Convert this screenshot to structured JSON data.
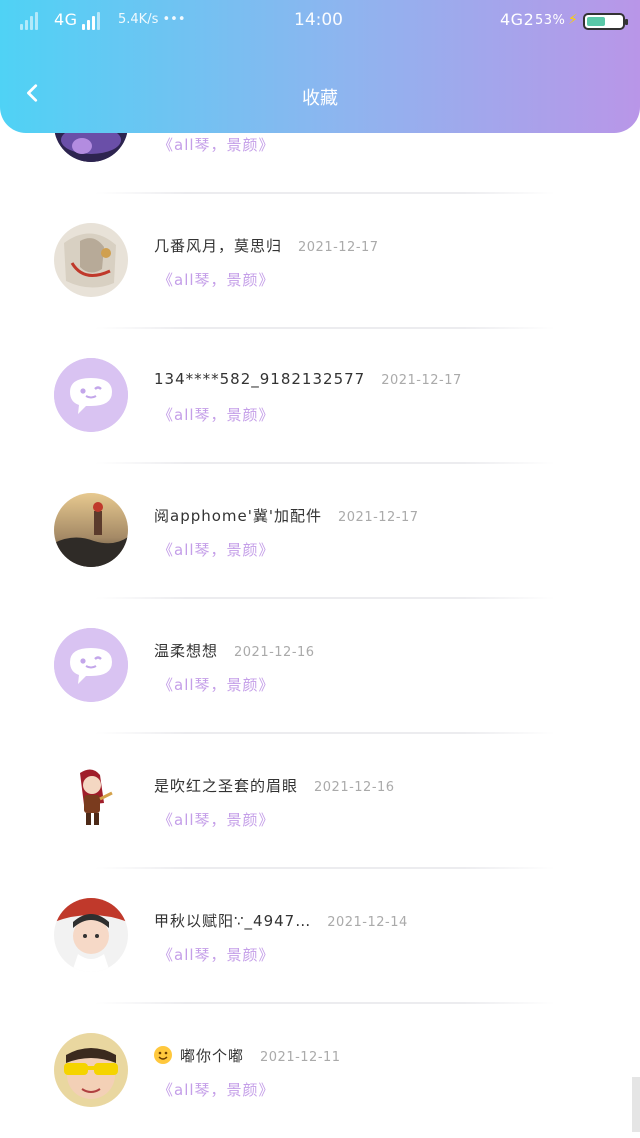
{
  "status_bar": {
    "network_left": "4G",
    "speed": "5.4K/s •••",
    "time": "14:00",
    "network_right": "4G2",
    "battery": "53%",
    "battery_level": 0.53
  },
  "header": {
    "title": "收藏"
  },
  "items": [
    {
      "name": "",
      "date": "",
      "subtitle": "《all琴，景颜》",
      "avatar": "photo-purple-stage"
    },
    {
      "name": "几番风月，莫思归",
      "date": "2021-12-17",
      "subtitle": "《all琴，景颜》",
      "avatar": "photo-anime-character"
    },
    {
      "name": "134****582_9182132577",
      "date": "2021-12-17",
      "subtitle": "《all琴，景颜》",
      "avatar": "default-chat-icon"
    },
    {
      "name": "阅apphome'冀'加配件",
      "date": "2021-12-17",
      "subtitle": "《all琴，景颜》",
      "avatar": "photo-sunset-figure"
    },
    {
      "name": "温柔想想",
      "date": "2021-12-16",
      "subtitle": "《all琴，景颜》",
      "avatar": "default-chat-icon"
    },
    {
      "name": "是吹红之圣套的眉眼",
      "date": "2021-12-16",
      "subtitle": "《all琴，景颜》",
      "avatar": "chibi-warrior"
    },
    {
      "name": "甲秋以赋阳∵_4947…",
      "date": "2021-12-14",
      "subtitle": "《all琴，景颜》",
      "avatar": "photo-boy-red"
    },
    {
      "name": "嘟你个嘟",
      "date": "2021-12-11",
      "subtitle": "《all琴，景颜》",
      "avatar": "photo-yellow-glasses",
      "emoji": "smile-emoji"
    }
  ]
}
